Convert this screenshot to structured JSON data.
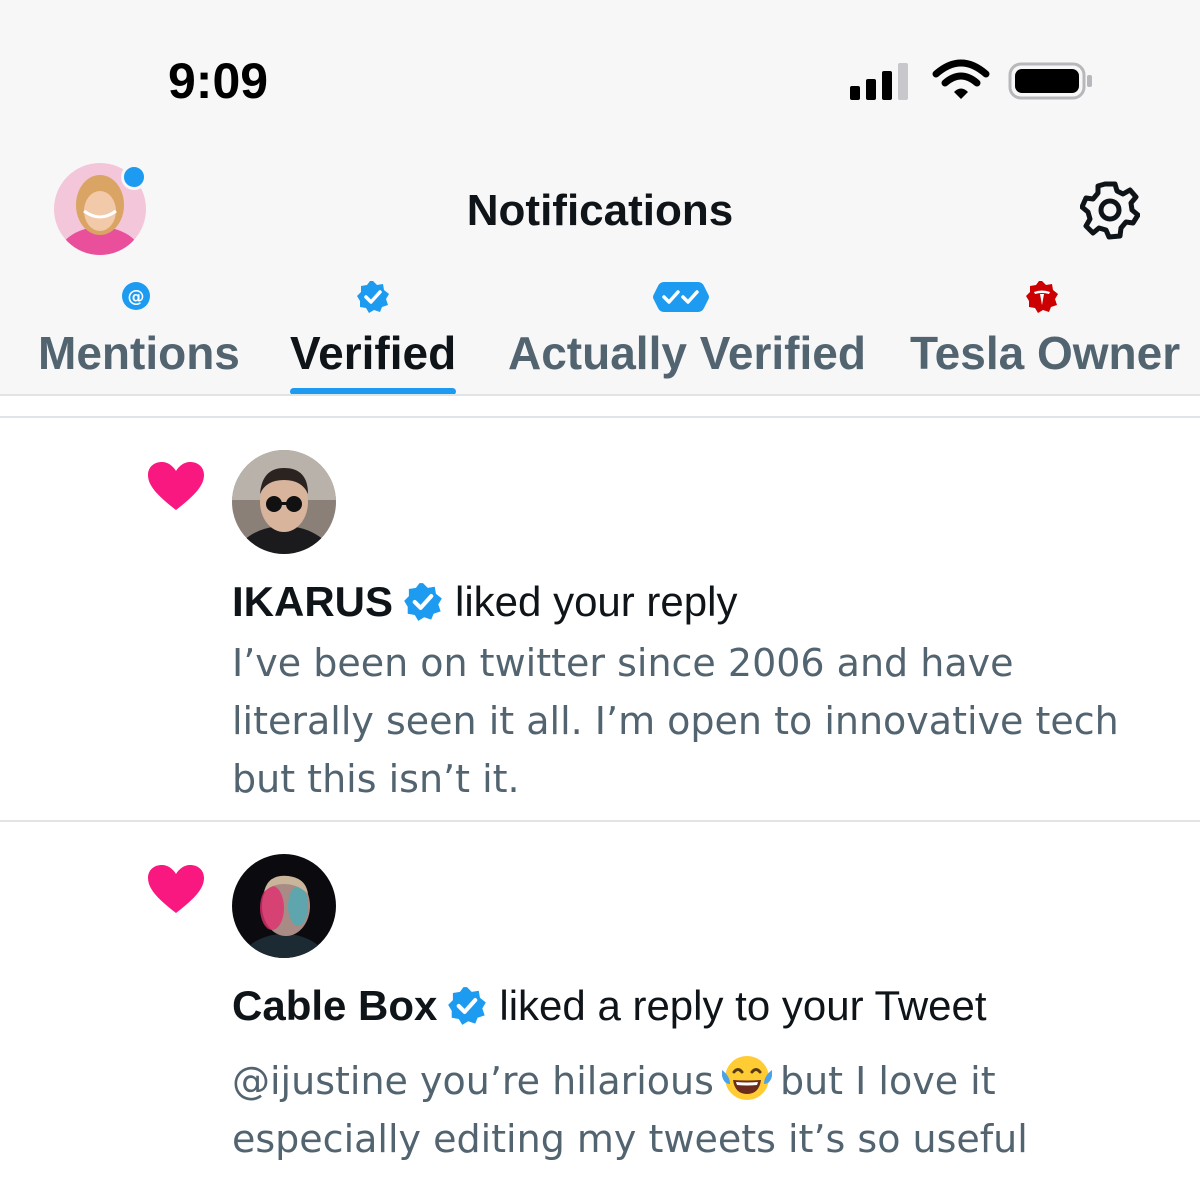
{
  "status_bar": {
    "time": "9:09",
    "icons": [
      "cellular-signal-icon",
      "wifi-icon",
      "battery-icon"
    ]
  },
  "header": {
    "title": "Notifications",
    "left_icon": "profile-avatar",
    "right_icon": "gear-icon"
  },
  "tabs": [
    {
      "label": "Mentions",
      "badge_icon": "at-badge-icon",
      "active": false
    },
    {
      "label": "Verified",
      "badge_icon": "verified-badge-icon",
      "active": true
    },
    {
      "label": "Actually Verified",
      "badge_icon": "double-check-badge-icon",
      "active": false
    },
    {
      "label": "Tesla Owner",
      "badge_icon": "tesla-badge-icon",
      "active": false
    }
  ],
  "notifications": [
    {
      "type_icon": "heart-icon",
      "name": "IKARUS",
      "verified": true,
      "action": "liked your reply",
      "text": "I’ve been on twitter since 2006 and have\nliterally seen it all. I’m open to innovative tech\nbut this isn’t it."
    },
    {
      "type_icon": "heart-icon",
      "name": "Cable Box",
      "verified": true,
      "action": "liked a reply to your Tweet",
      "text_before_emoji": "@ijustine you’re hilarious",
      "emoji": "face-with-tears-of-joy-emoji",
      "text_after_emoji": "but I love it\nespecially editing my tweets it’s so useful"
    }
  ],
  "colors": {
    "accent": "#1d9bf0",
    "heart": "#f91880",
    "tesla_red": "#cc0000",
    "text_primary": "#0f1419",
    "text_secondary": "#536471"
  }
}
